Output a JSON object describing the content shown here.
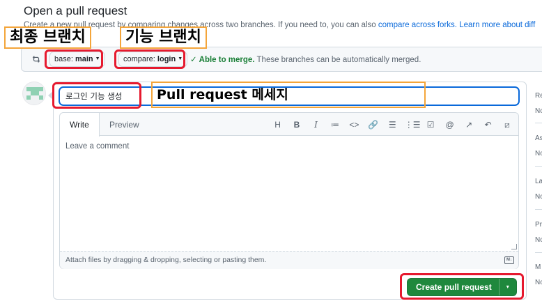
{
  "header": {
    "title": "Open a pull request",
    "subtitle_prefix": "Create a new pull request by comparing changes across two branches. If you need to, you can also ",
    "subtitle_link1": "compare across forks.",
    "subtitle_link2": "Learn more about diff"
  },
  "compare": {
    "base_prefix": "base: ",
    "base_branch": "main",
    "compare_prefix": "compare: ",
    "compare_branch": "login",
    "arrow": "←",
    "ellipsis": "...",
    "status_ok": "Able to merge.",
    "status_text": " These branches can be automatically merged."
  },
  "form": {
    "title_value": "로그인 기능 생성",
    "tab_write": "Write",
    "tab_preview": "Preview",
    "toolbar": [
      "H",
      "B",
      "I",
      "≔",
      "<>",
      "🔗",
      "☰",
      "⋮☰",
      "☑",
      "@",
      "↗",
      "↶",
      "⧄"
    ],
    "comment_placeholder": "Leave a comment",
    "attach_text": "Attach files by dragging & dropping, selecting or pasting them.",
    "md_badge": "M↓",
    "create_button": "Create pull request",
    "create_dropdown": "▾"
  },
  "sidebar": {
    "items": [
      {
        "key": "Re",
        "value": "No"
      },
      {
        "key": "As",
        "value": "No"
      },
      {
        "key": "La",
        "value": "No"
      },
      {
        "key": "Pr",
        "value": "No"
      },
      {
        "key": "M",
        "value": "No"
      }
    ]
  },
  "annotations": {
    "final_branch": "최종 브랜치",
    "feature_branch": "기능 브랜치",
    "pr_message": "Pull request 메세지"
  },
  "colors": {
    "accent_blue": "#0969da",
    "success_green": "#1a7f37",
    "button_green": "#1f883d",
    "annotation_red": "#e6192e",
    "annotation_orange": "#f4a53a"
  },
  "icons": {
    "compare": "git-compare-icon",
    "avatar": "identicon-avatar",
    "markdown": "markdown-icon"
  }
}
